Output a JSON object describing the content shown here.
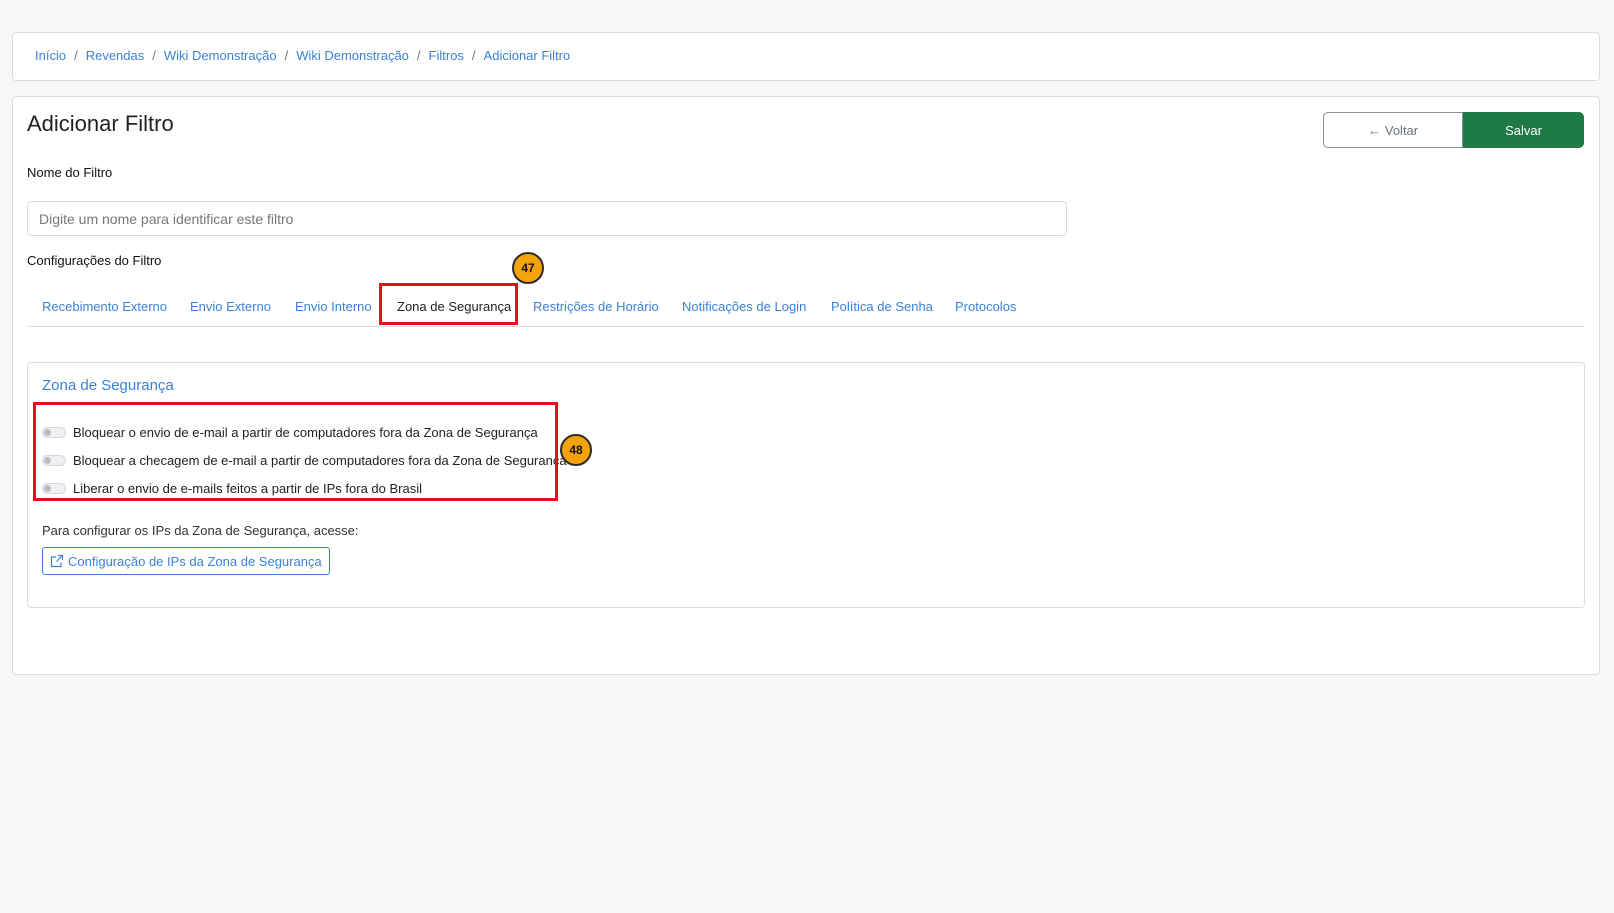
{
  "breadcrumb": [
    "Início",
    "Revendas",
    "Wiki Demonstração",
    "Wiki Demonstração",
    "Filtros",
    "Adicionar Filtro"
  ],
  "breadcrumb_sep": "/",
  "page": {
    "title": "Adicionar Filtro"
  },
  "actions": {
    "back_label": "Voltar",
    "back_icon": "←",
    "save_label": "Salvar"
  },
  "colors": {
    "accent": "#3b82d6",
    "save": "#1f7a45",
    "highlight": "#e3101b",
    "badge": "#f4a40a"
  },
  "form": {
    "name_label": "Nome do Filtro",
    "name_value": "",
    "name_placeholder": "Digite um nome para identificar este filtro",
    "config_label": "Configurações do Filtro"
  },
  "tabs": [
    "Recebimento Externo",
    "Envio Externo",
    "Envio Interno",
    "Zona de Segurança",
    "Restrições de Horário",
    "Notificações de Login",
    "Política de Senha",
    "Protocolos"
  ],
  "active_tab": "Zona de Segurança",
  "zone": {
    "title": "Zona de Segurança",
    "options": [
      {
        "label": "Bloquear o envio de e-mail a partir de computadores fora da Zona de Segurança",
        "checked": false
      },
      {
        "label": "Bloquear a checagem de e-mail a partir de computadores fora da Zona de Segurança",
        "checked": false
      },
      {
        "label": "Liberar o envio de e-mails feitos a partir de IPs fora do Brasil",
        "checked": false
      }
    ],
    "note": "Para configurar os IPs da Zona de Segurança, acesse:",
    "link_label": "Configuração de IPs da Zona de Segurança"
  },
  "annotations": {
    "badge_tab": "47",
    "badge_options": "48"
  }
}
